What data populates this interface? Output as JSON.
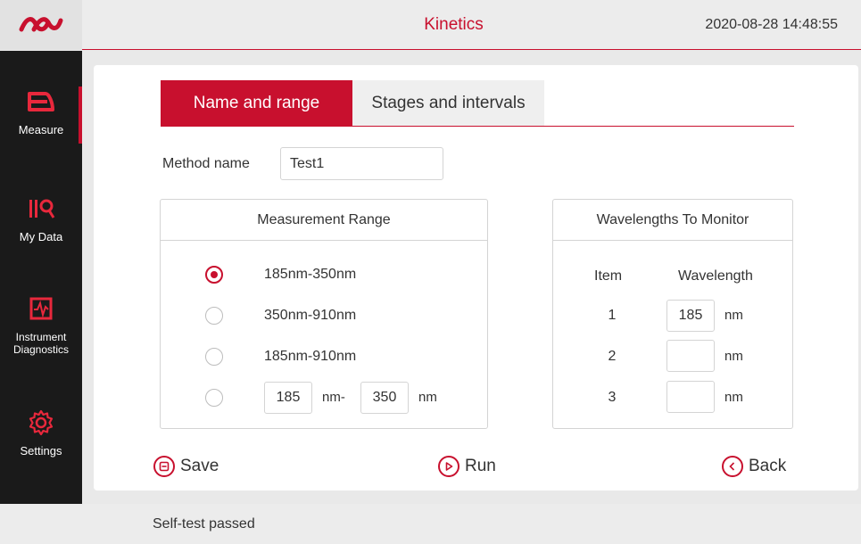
{
  "header": {
    "title": "Kinetics",
    "datetime": "2020-08-28 14:48:55"
  },
  "sidebar": {
    "items": [
      {
        "label": "Measure",
        "icon": "measure-icon",
        "active": true
      },
      {
        "label": "My Data",
        "icon": "my-data-icon",
        "active": false
      },
      {
        "label": "Instrument Diagnostics",
        "icon": "diagnostics-icon",
        "active": false
      },
      {
        "label": "Settings",
        "icon": "gear-icon",
        "active": false
      }
    ]
  },
  "tabs": [
    {
      "label": "Name and range",
      "active": true
    },
    {
      "label": "Stages and intervals",
      "active": false
    }
  ],
  "method": {
    "label": "Method name",
    "value": "Test1"
  },
  "measurement_range": {
    "title": "Measurement Range",
    "options": [
      {
        "label": "185nm-350nm",
        "selected": true
      },
      {
        "label": "350nm-910nm",
        "selected": false
      },
      {
        "label": "185nm-910nm",
        "selected": false
      }
    ],
    "custom": {
      "from": "185",
      "mid_unit": "nm-",
      "to": "350",
      "end_unit": "nm",
      "selected": false
    }
  },
  "wavelengths": {
    "title": "Wavelengths To Monitor",
    "col_item": "Item",
    "col_wavelength": "Wavelength",
    "unit": "nm",
    "rows": [
      {
        "item": "1",
        "value": "185"
      },
      {
        "item": "2",
        "value": ""
      },
      {
        "item": "3",
        "value": ""
      }
    ]
  },
  "actions": {
    "save": "Save",
    "run": "Run",
    "back": "Back"
  },
  "status": {
    "text": "Self-test passed"
  },
  "colors": {
    "accent": "#c8102e",
    "sidebar_bg": "#1a1a1a",
    "page_bg": "#e9e9e9"
  }
}
